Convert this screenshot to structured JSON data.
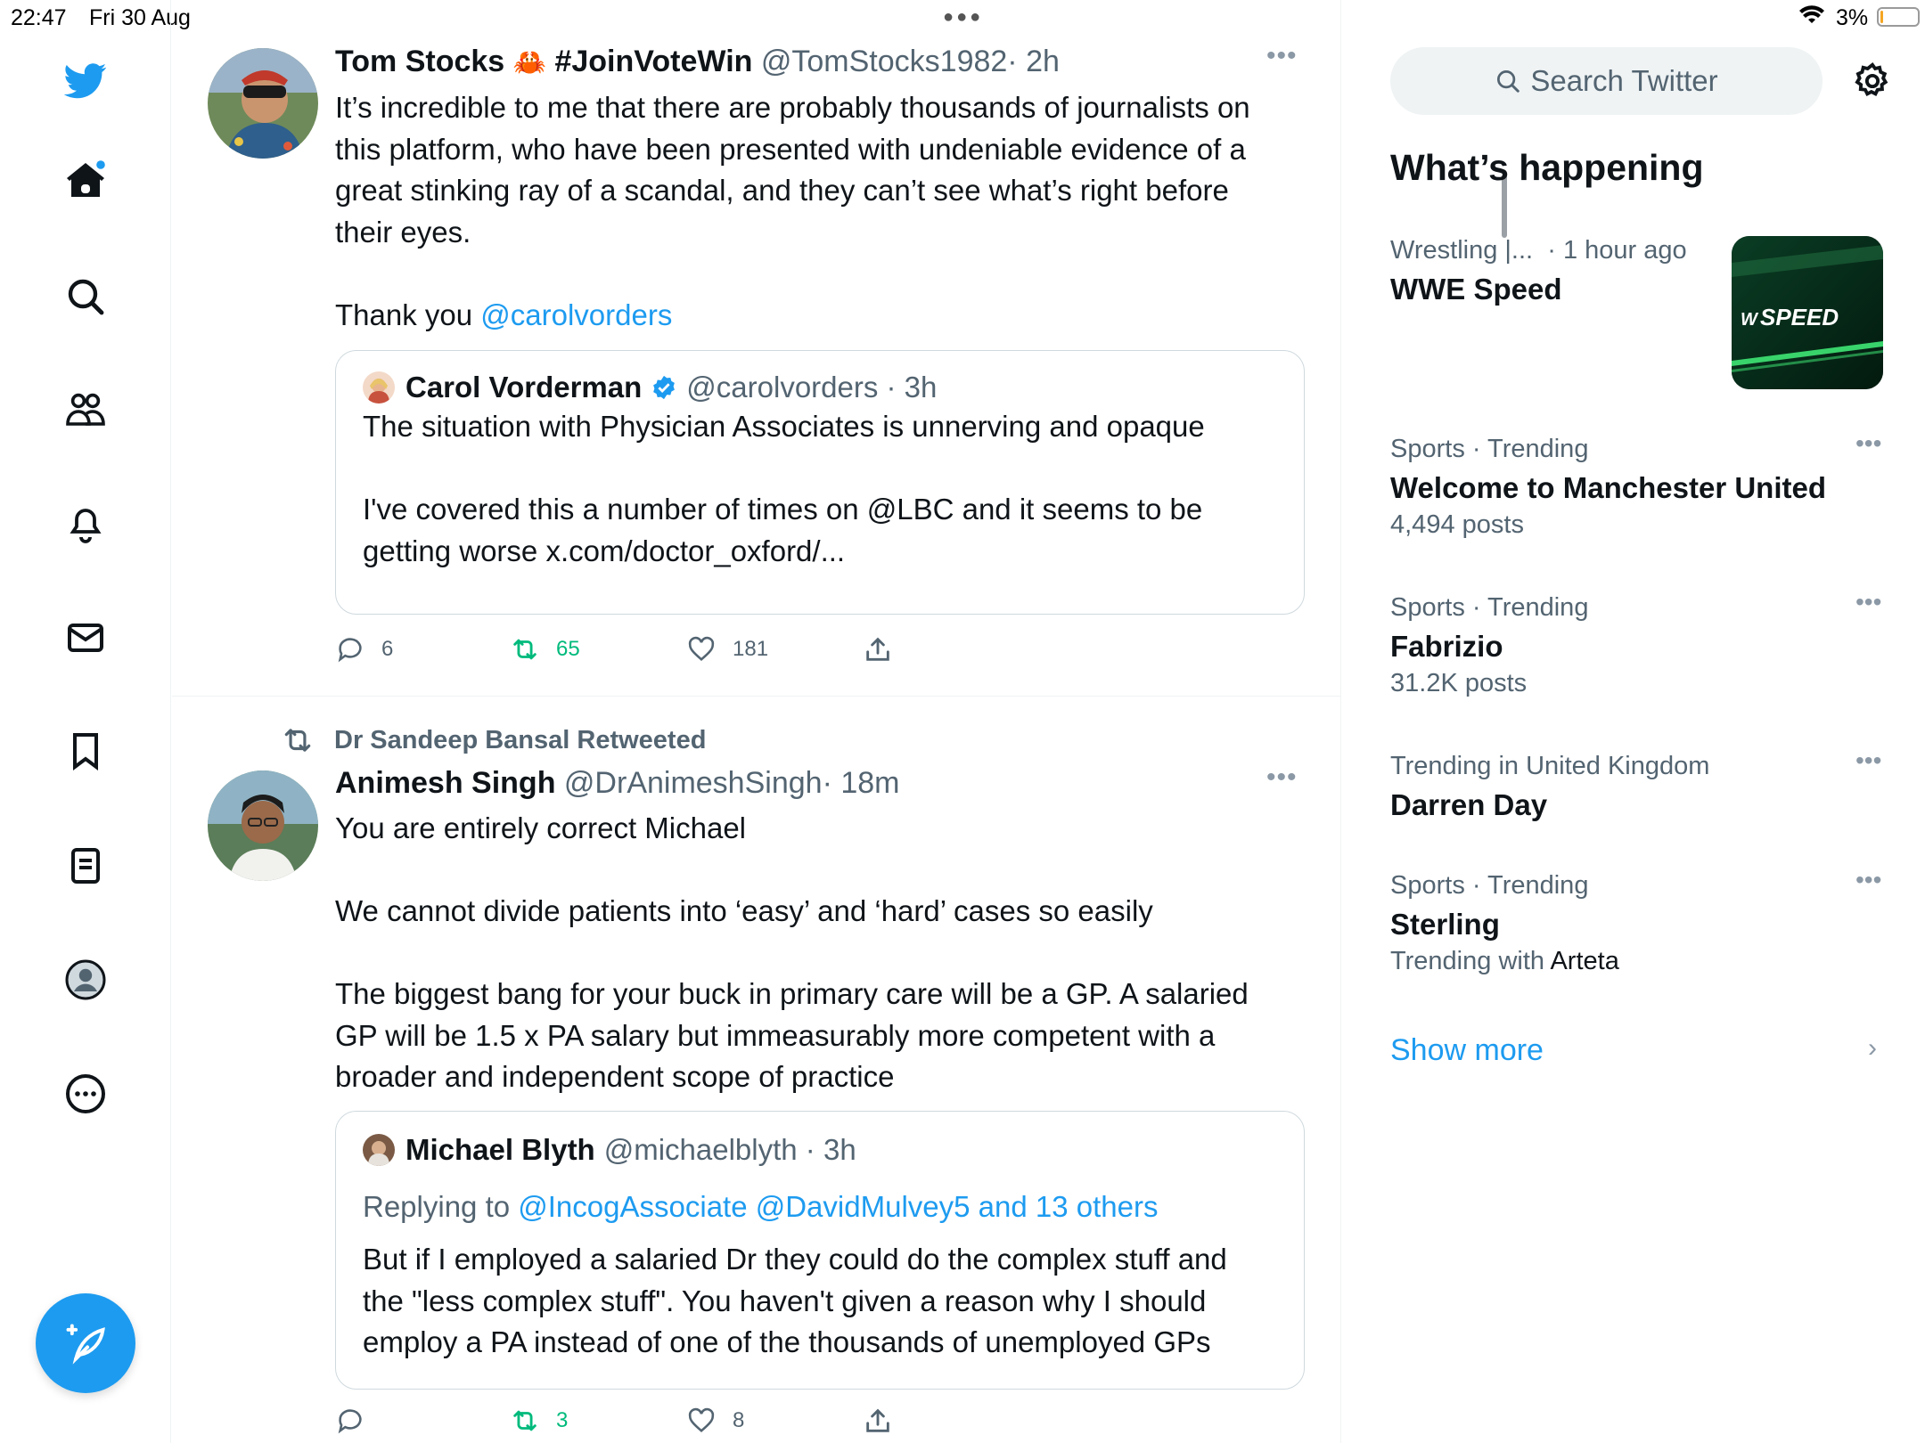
{
  "status": {
    "time": "22:47",
    "date": "Fri 30 Aug",
    "battery": "3%"
  },
  "nav": {
    "icons": [
      "twitter-logo",
      "home-icon",
      "search-icon",
      "communities-icon",
      "notifications-icon",
      "messages-icon",
      "bookmarks-icon",
      "lists-icon",
      "profile-icon",
      "more-icon"
    ],
    "compose": "compose-icon"
  },
  "tweets": [
    {
      "name": "Tom Stocks",
      "emoji": "🦀",
      "hashtag": "#JoinVoteWin",
      "handle": "@TomStocks1982",
      "time": "· 2h",
      "text_lines": [
        "It’s incredible to me that there are probably thousands of journalists on",
        "this platform, who have been presented with undeniable evidence of a",
        "great stinking ray of a scandal, and they can’t see what’s right before",
        "their eyes."
      ],
      "thanks_prefix": "Thank you ",
      "thanks_link": "@carolvorders",
      "quote": {
        "name": "Carol Vorderman",
        "handle": "@carolvorders · 3h",
        "line1": "The situation with Physician Associates is unnerving and opaque",
        "line2": "I've covered this a number of times on @LBC and it seems to be",
        "line3": "getting worse x.com/doctor_oxford/..."
      },
      "replies": "6",
      "retweets": "65",
      "likes": "181"
    },
    {
      "retweeted_by": "Dr Sandeep Bansal Retweeted",
      "name": "Animesh Singh",
      "handle": "@DrAnimeshSingh",
      "time": "· 18m",
      "p1": "You are entirely correct Michael",
      "p2": "We cannot divide patients into ‘easy’ and ‘hard’ cases so easily",
      "p3_lines": [
        "The biggest bang for your buck in primary care will be a GP. A salaried",
        "GP will be 1.5 x PA salary but immeasurably more competent with a",
        "broader and independent scope of practice"
      ],
      "quote": {
        "name": "Michael Blyth",
        "handle": "@michaelblyth · 3h",
        "reply_prefix": "Replying to ",
        "reply_to": "@IncogAssociate @DavidMulvey5 and 13 others",
        "lines": [
          "But if I employed a salaried Dr they could do the complex stuff and",
          "the \"less complex stuff\". You haven't given a reason why I should",
          "employ a PA instead of one of the thousands of unemployed GPs"
        ]
      },
      "replies": "",
      "retweets": "3",
      "likes": "8"
    }
  ],
  "sidebar": {
    "search_placeholder": "Search Twitter",
    "title": "What’s happening",
    "trends": [
      {
        "context": "Wrestling |...",
        "time": "· 1 hour ago",
        "name": "WWE Speed",
        "image_text": "SPEED"
      },
      {
        "context": "Sports · Trending",
        "name": "Welcome to Manchester United",
        "count": "4,494 posts"
      },
      {
        "context": "Sports · Trending",
        "name": "Fabrizio",
        "count": "31.2K posts"
      },
      {
        "context": "Trending in United Kingdom",
        "name": "Darren Day"
      },
      {
        "context": "Sports · Trending",
        "name": "Sterling",
        "with_prefix": "Trending with ",
        "with_name": "Arteta"
      }
    ],
    "show_more": "Show more"
  },
  "colors": {
    "accent": "#1d9bf0",
    "retweet": "#00ba7c",
    "muted": "#536471"
  }
}
